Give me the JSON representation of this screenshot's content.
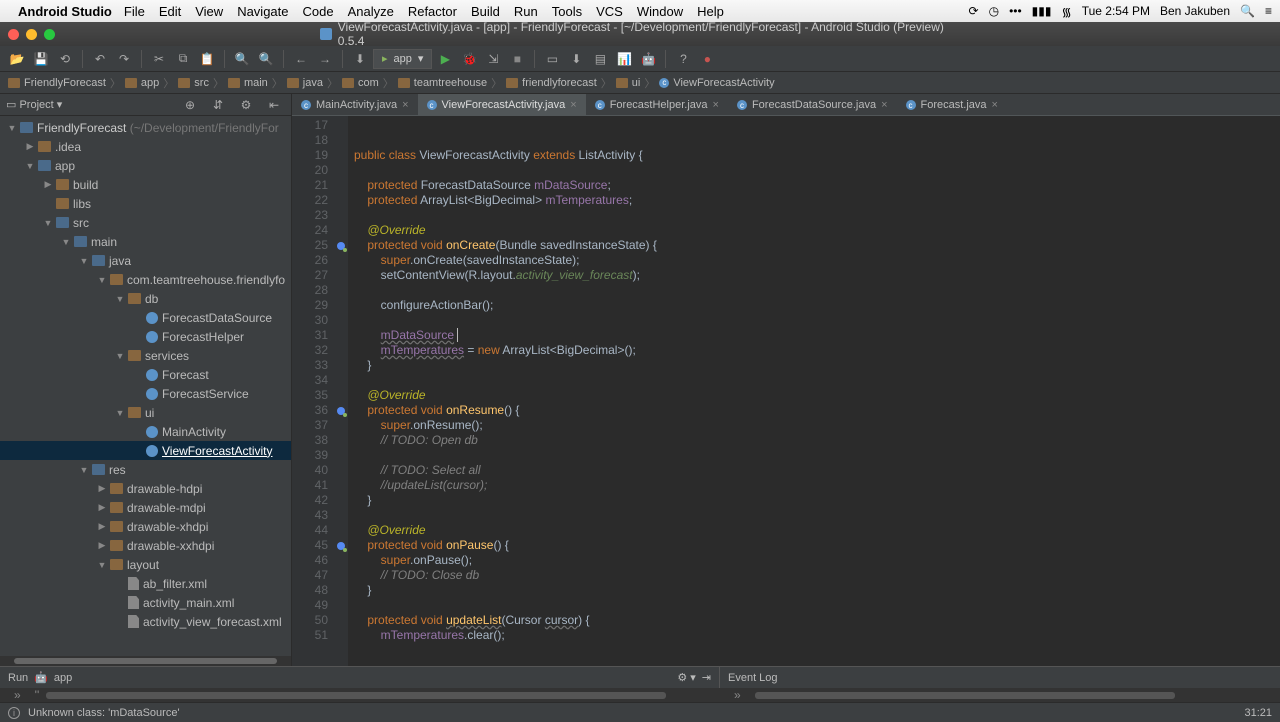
{
  "menubar": {
    "app": "Android Studio",
    "items": [
      "File",
      "Edit",
      "View",
      "Navigate",
      "Code",
      "Analyze",
      "Refactor",
      "Build",
      "Run",
      "Tools",
      "VCS",
      "Window",
      "Help"
    ],
    "clock": "Tue 2:54 PM",
    "user": "Ben Jakuben"
  },
  "window": {
    "title": "ViewForecastActivity.java - [app] - FriendlyForecast - [~/Development/FriendlyForecast] - Android Studio (Preview) 0.5.4"
  },
  "toolbar": {
    "run_config": "app"
  },
  "breadcrumb": [
    "FriendlyForecast",
    "app",
    "src",
    "main",
    "java",
    "com",
    "teamtreehouse",
    "friendlyforecast",
    "ui",
    "ViewForecastActivity"
  ],
  "sidebar": {
    "title": "Project",
    "root": "FriendlyForecast",
    "root_hint": "(~/Development/FriendlyFor",
    "tree": [
      {
        "d": 1,
        "k": "folder",
        "n": ".idea",
        "a": "r"
      },
      {
        "d": 1,
        "k": "folderb",
        "n": "app",
        "a": "d"
      },
      {
        "d": 2,
        "k": "folder",
        "n": "build",
        "a": "r"
      },
      {
        "d": 2,
        "k": "folder",
        "n": "libs"
      },
      {
        "d": 2,
        "k": "folderb",
        "n": "src",
        "a": "d"
      },
      {
        "d": 3,
        "k": "folderb",
        "n": "main",
        "a": "d"
      },
      {
        "d": 4,
        "k": "folderb",
        "n": "java",
        "a": "d"
      },
      {
        "d": 5,
        "k": "folder",
        "n": "com.teamtreehouse.friendlyfo",
        "a": "d"
      },
      {
        "d": 6,
        "k": "folder",
        "n": "db",
        "a": "d"
      },
      {
        "d": 7,
        "k": "cls",
        "n": "ForecastDataSource"
      },
      {
        "d": 7,
        "k": "cls",
        "n": "ForecastHelper"
      },
      {
        "d": 6,
        "k": "folder",
        "n": "services",
        "a": "d"
      },
      {
        "d": 7,
        "k": "cls",
        "n": "Forecast"
      },
      {
        "d": 7,
        "k": "cls",
        "n": "ForecastService"
      },
      {
        "d": 6,
        "k": "folder",
        "n": "ui",
        "a": "d"
      },
      {
        "d": 7,
        "k": "cls",
        "n": "MainActivity"
      },
      {
        "d": 7,
        "k": "cls",
        "n": "ViewForecastActivity",
        "sel": true
      },
      {
        "d": 4,
        "k": "folderb",
        "n": "res",
        "a": "d"
      },
      {
        "d": 5,
        "k": "folder",
        "n": "drawable-hdpi",
        "a": "r"
      },
      {
        "d": 5,
        "k": "folder",
        "n": "drawable-mdpi",
        "a": "r"
      },
      {
        "d": 5,
        "k": "folder",
        "n": "drawable-xhdpi",
        "a": "r"
      },
      {
        "d": 5,
        "k": "folder",
        "n": "drawable-xxhdpi",
        "a": "r"
      },
      {
        "d": 5,
        "k": "folder",
        "n": "layout",
        "a": "d"
      },
      {
        "d": 6,
        "k": "xml",
        "n": "ab_filter.xml"
      },
      {
        "d": 6,
        "k": "xml",
        "n": "activity_main.xml"
      },
      {
        "d": 6,
        "k": "xml",
        "n": "activity_view_forecast.xml"
      }
    ]
  },
  "tabs": [
    {
      "label": "MainActivity.java"
    },
    {
      "label": "ViewForecastActivity.java",
      "active": true
    },
    {
      "label": "ForecastHelper.java"
    },
    {
      "label": "ForecastDataSource.java"
    },
    {
      "label": "Forecast.java"
    }
  ],
  "code": {
    "start": 17,
    "lines": [
      "",
      "",
      "<kw>public class</kw> ViewForecastActivity <kw>extends</kw> ListActivity {",
      "",
      "    <kw>protected</kw> ForecastDataSource <fld>mDataSource</fld>;",
      "    <kw>protected</kw> ArrayList&lt;BigDecimal&gt; <fld>mTemperatures</fld>;",
      "",
      "    <ann>@Override</ann>",
      "    <kw>protected void</kw> <mth>onCreate</mth>(Bundle savedInstanceState) {",
      "        <kw>super</kw>.onCreate(savedInstanceState);",
      "        setContentView(R.layout.<str><i>activity_view_forecast</i></str>);",
      "",
      "        configureActionBar();",
      "",
      "        <fld><span class='und'>mDataSource</span></fld> <span class='cur'></span>",
      "        <fld><span class='und'>mTemperatures</span></fld> = <kw>new</kw> ArrayList&lt;BigDecimal&gt;();",
      "    }",
      "",
      "    <ann>@Override</ann>",
      "    <kw>protected void</kw> <mth>onResume</mth>() {",
      "        <kw>super</kw>.onResume();",
      "        <cmt>// TODO: Open db</cmt>",
      "",
      "        <cmt>// TODO: Select all</cmt>",
      "        <cmt>//updateList(cursor);</cmt>",
      "    }",
      "",
      "    <ann>@Override</ann>",
      "    <kw>protected void</kw> <mth>onPause</mth>() {",
      "        <kw>super</kw>.onPause();",
      "        <cmt>// TODO: Close db</cmt>",
      "    }",
      "",
      "    <kw>protected void</kw> <mth><span class='und'>updateList</span></mth>(Cursor <span class='und'>cursor</span>) {",
      "        <fld>mTemperatures</fld>.clear();"
    ],
    "override_rows": [
      25,
      36,
      45
    ]
  },
  "bottom": {
    "run": "Run",
    "run_app": "app",
    "eventlog": "Event Log"
  },
  "status": {
    "msg": "Unknown class: 'mDataSource'",
    "pos": "31:21"
  }
}
